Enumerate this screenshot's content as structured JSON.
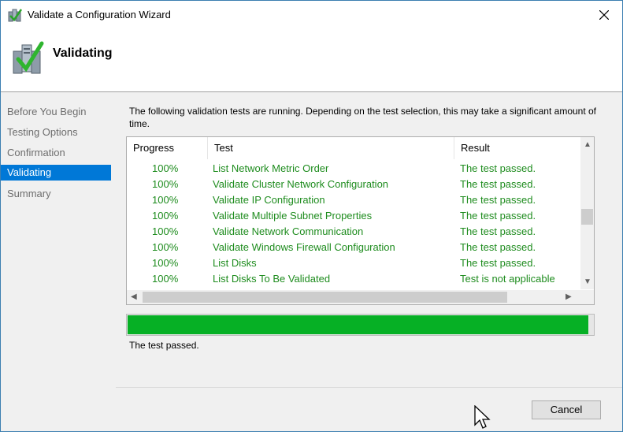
{
  "window": {
    "title": "Validate a Configuration Wizard"
  },
  "header": {
    "title": "Validating"
  },
  "sidebar": {
    "items": [
      {
        "label": "Before You Begin",
        "active": false
      },
      {
        "label": "Testing Options",
        "active": false
      },
      {
        "label": "Confirmation",
        "active": false
      },
      {
        "label": "Validating",
        "active": true
      },
      {
        "label": "Summary",
        "active": false
      }
    ]
  },
  "main": {
    "intro": "The following validation tests are running. Depending on the test selection, this may take a significant amount of time.",
    "columns": [
      "Progress",
      "Test",
      "Result"
    ],
    "rows": [
      {
        "progress": "100%",
        "test": "List Network Metric Order",
        "result": "The test passed."
      },
      {
        "progress": "100%",
        "test": "Validate Cluster Network Configuration",
        "result": "The test passed."
      },
      {
        "progress": "100%",
        "test": "Validate IP Configuration",
        "result": "The test passed."
      },
      {
        "progress": "100%",
        "test": "Validate Multiple Subnet Properties",
        "result": "The test passed."
      },
      {
        "progress": "100%",
        "test": "Validate Network Communication",
        "result": "The test passed."
      },
      {
        "progress": "100%",
        "test": "Validate Windows Firewall Configuration",
        "result": "The test passed."
      },
      {
        "progress": "100%",
        "test": "List Disks",
        "result": "The test passed."
      },
      {
        "progress": "100%",
        "test": "List Disks To Be Validated",
        "result": "Test is not applicable"
      }
    ],
    "overall_progress": 1.0,
    "status": "The test passed."
  },
  "footer": {
    "cancel_label": "Cancel"
  },
  "colors": {
    "accent": "#0078d7",
    "progress": "#06b025",
    "pass_text": "#1e8c1e"
  }
}
